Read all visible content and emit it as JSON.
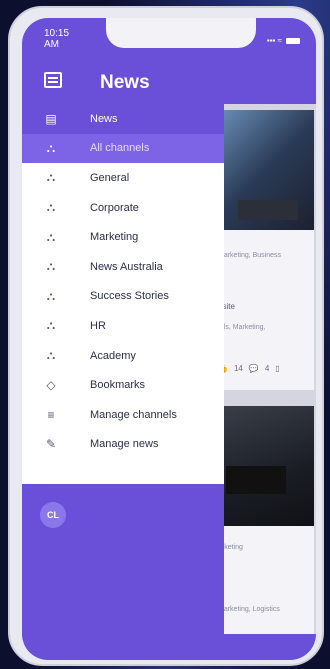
{
  "status": {
    "time": "10:15\nAM",
    "signal": "▪▪▪ ≈"
  },
  "appbar": {
    "title": "News",
    "menu_icon": "news-menu-icon"
  },
  "drawer": {
    "items": [
      {
        "label": "News",
        "icon": "newspaper-icon",
        "glyph": "▤",
        "state": "header"
      },
      {
        "label": "All channels",
        "icon": "channels-icon",
        "glyph": "⛬",
        "state": "active"
      },
      {
        "label": "General",
        "icon": "channel-icon",
        "glyph": "⛬",
        "state": ""
      },
      {
        "label": "Corporate",
        "icon": "channel-icon",
        "glyph": "⛬",
        "state": ""
      },
      {
        "label": "Marketing",
        "icon": "channel-icon",
        "glyph": "⛬",
        "state": ""
      },
      {
        "label": "News Australia",
        "icon": "channel-icon",
        "glyph": "⛬",
        "state": ""
      },
      {
        "label": "Success Stories",
        "icon": "channel-icon",
        "glyph": "⛬",
        "state": ""
      },
      {
        "label": "HR",
        "icon": "channel-icon",
        "glyph": "⛬",
        "state": ""
      },
      {
        "label": "Academy",
        "icon": "channel-icon",
        "glyph": "⛬",
        "state": ""
      },
      {
        "label": "Bookmarks",
        "icon": "bookmark-icon",
        "glyph": "◇",
        "state": ""
      },
      {
        "label": "Manage channels",
        "icon": "list-icon",
        "glyph": "≡",
        "state": ""
      },
      {
        "label": "Manage news",
        "icon": "pencil-icon",
        "glyph": "✎",
        "state": ""
      }
    ],
    "avatar_initials": "CL"
  },
  "cards": [
    {
      "tags": "Marketing, Business",
      "title_fragment": "bsite",
      "tags2": "tals, Marketing,",
      "likes": "14",
      "comments": "4"
    },
    {
      "tags": "arketing",
      "tags2": "Marketing, Logistics"
    }
  ],
  "colors": {
    "accent": "#6a4fd9",
    "active": "#7d63e6"
  }
}
